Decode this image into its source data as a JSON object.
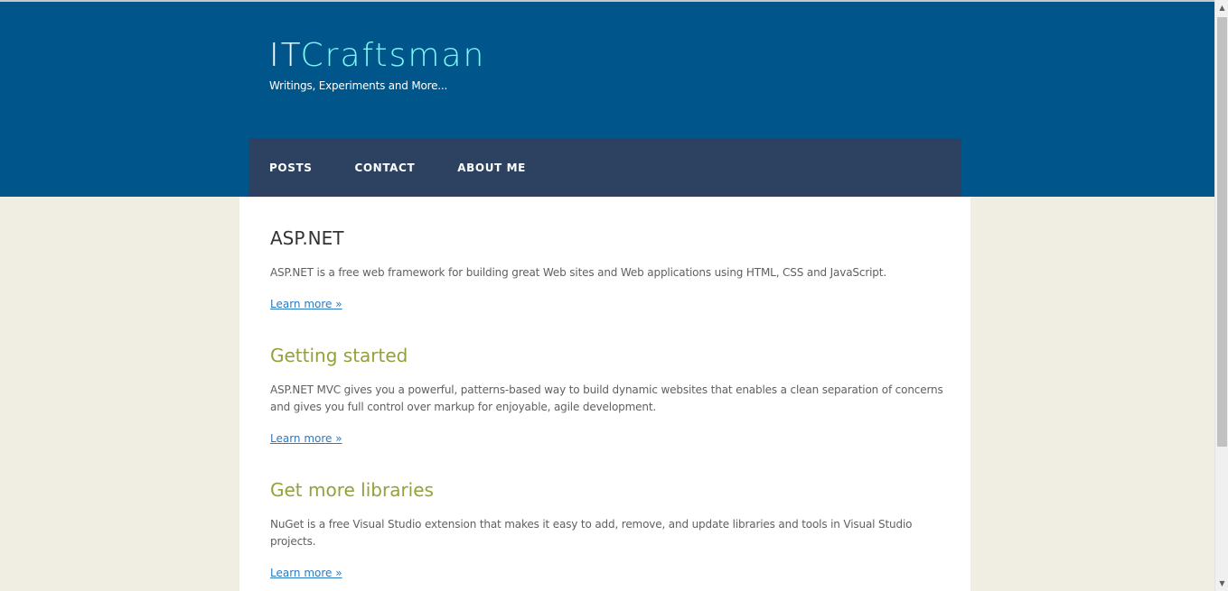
{
  "header": {
    "brand_part1": "IT",
    "brand_part2": "Craftsman",
    "tagline": "Writings, Experiments and More...",
    "colors": {
      "header_bg": "#00568a",
      "nav_bg": "#2d4260",
      "brand_accent": "#7ef5f7"
    }
  },
  "nav": {
    "items": [
      {
        "label": "POSTS"
      },
      {
        "label": "CONTACT"
      },
      {
        "label": "ABOUT ME"
      }
    ]
  },
  "main": {
    "sections": [
      {
        "heading": "ASP.NET",
        "body": "ASP.NET is a free web framework for building great Web sites and Web applications using HTML, CSS and JavaScript.",
        "link": "Learn more »"
      },
      {
        "heading": "Getting started",
        "body": "ASP.NET MVC gives you a powerful, patterns-based way to build dynamic websites that enables a clean separation of concerns and gives you full control over markup for enjoyable, agile development.",
        "link": "Learn more »"
      },
      {
        "heading": "Get more libraries",
        "body": "NuGet is a free Visual Studio extension that makes it easy to add, remove, and update libraries and tools in Visual Studio projects.",
        "link": "Learn more »"
      }
    ]
  },
  "scrollbar": {
    "up_icon": "chevron-up-icon",
    "down_icon": "chevron-down-icon"
  }
}
